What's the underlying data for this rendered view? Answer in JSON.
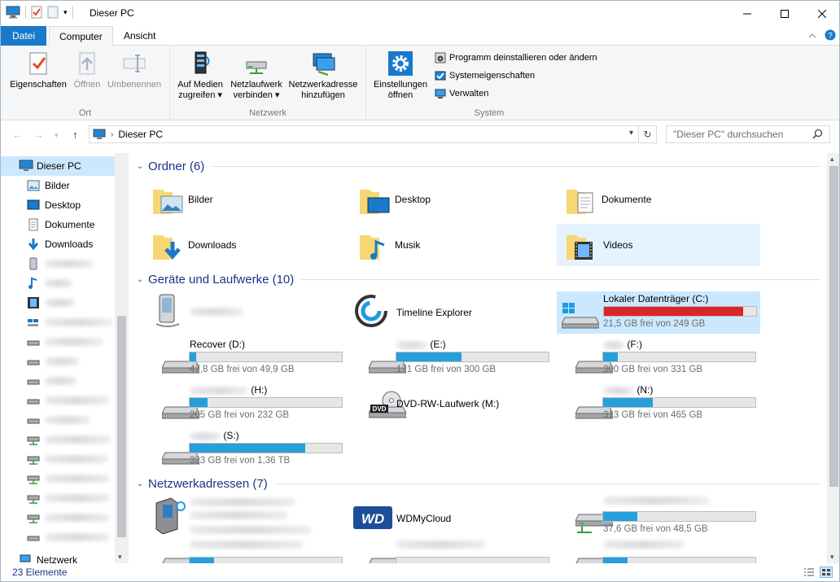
{
  "window": {
    "title": "Dieser PC",
    "controls": {
      "minimize": "—",
      "maximize": "☐",
      "close": "✕"
    }
  },
  "ribbon": {
    "tabs": [
      "Datei",
      "Computer",
      "Ansicht"
    ],
    "active_tab": "Computer",
    "groups": {
      "ort": {
        "name": "Ort",
        "buttons": [
          {
            "label": "Eigenschaften",
            "icon": "checkmark-properties-icon",
            "enabled": true
          },
          {
            "label": "Öffnen",
            "icon": "open-icon",
            "enabled": false
          },
          {
            "label": "Umbenennen",
            "icon": "rename-icon",
            "enabled": false
          }
        ]
      },
      "netzwerk": {
        "name": "Netzwerk",
        "buttons": [
          {
            "line1": "Auf Medien",
            "line2": "zugreifen",
            "icon": "media-access-icon"
          },
          {
            "line1": "Netzlaufwerk",
            "line2": "verbinden",
            "icon": "network-drive-icon"
          },
          {
            "line1": "Netzwerkadresse",
            "line2": "hinzufügen",
            "icon": "network-location-icon"
          }
        ]
      },
      "system": {
        "name": "System",
        "big_button": {
          "line1": "Einstellungen",
          "line2": "öffnen",
          "icon": "gear-icon"
        },
        "small_buttons": [
          {
            "label": "Programm deinstallieren oder ändern",
            "icon": "uninstall-icon"
          },
          {
            "label": "Systemeigenschaften",
            "icon": "system-properties-icon"
          },
          {
            "label": "Verwalten",
            "icon": "manage-icon"
          }
        ]
      }
    }
  },
  "address": {
    "path": "Dieser PC",
    "search_placeholder": "\"Dieser PC\" durchsuchen"
  },
  "sidebar": {
    "items": [
      {
        "label": "Dieser PC",
        "icon": "computer-icon",
        "selected": true
      },
      {
        "label": "Bilder",
        "icon": "pictures-icon"
      },
      {
        "label": "Desktop",
        "icon": "desktop-icon"
      },
      {
        "label": "Dokumente",
        "icon": "documents-icon"
      },
      {
        "label": "Downloads",
        "icon": "downloads-icon"
      }
    ],
    "bottom_item": "Netzwerk"
  },
  "sections": {
    "ordner": "Ordner (6)",
    "geraete": "Geräte und Laufwerke (10)",
    "netzwerk": "Netzwerkadressen (7)"
  },
  "folders": [
    {
      "label": "Bilder",
      "icon": "pictures-folder-icon"
    },
    {
      "label": "Desktop",
      "icon": "desktop-folder-icon"
    },
    {
      "label": "Dokumente",
      "icon": "documents-folder-icon"
    },
    {
      "label": "Downloads",
      "icon": "downloads-folder-icon"
    },
    {
      "label": "Musik",
      "icon": "music-folder-icon"
    },
    {
      "label": "Videos",
      "icon": "videos-folder-icon",
      "selected": true
    }
  ],
  "drives": {
    "timeline": "Timeline Explorer",
    "c": {
      "name": "Lokaler Datenträger (C:)",
      "free": "21,5 GB frei von 249 GB",
      "used_fraction": 0.914
    },
    "d": {
      "name": "Recover (D:)",
      "free": "47,8 GB frei von 49,9 GB",
      "used_fraction": 0.042
    },
    "e": {
      "name": "(E:)",
      "free": "171 GB frei von 300 GB",
      "used_fraction": 0.43
    },
    "f": {
      "name": "(F:)",
      "free": "300 GB frei von 331 GB",
      "used_fraction": 0.094
    },
    "h": {
      "name": "(H:)",
      "free": "205 GB frei von 232 GB",
      "used_fraction": 0.116
    },
    "m": {
      "name": "DVD-RW-Laufwerk (M:)"
    },
    "n": {
      "name": "(N:)",
      "free": "313 GB frei von 465 GB",
      "used_fraction": 0.327
    },
    "s": {
      "name": "(S:)",
      "free": "323 GB frei von 1,36 TB",
      "used_fraction": 0.762
    }
  },
  "network": {
    "wd": "WDMyCloud",
    "share1": {
      "free": "37,6 GB frei von 48,5 GB",
      "used_fraction": 0.225
    }
  },
  "status": {
    "count": "23 Elemente"
  }
}
